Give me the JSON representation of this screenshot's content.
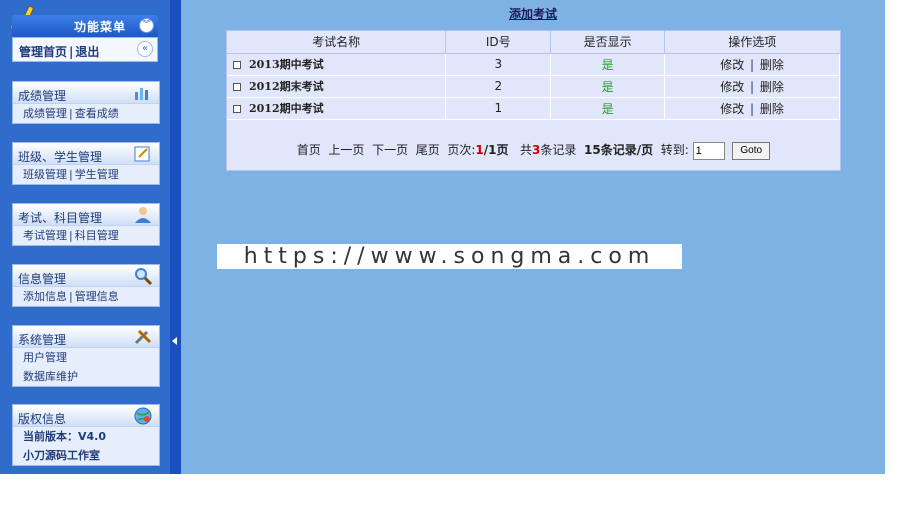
{
  "sidebar": {
    "menu_title": "功能菜单",
    "home_label": "管理首页",
    "logout_label": "退出",
    "blocks": [
      {
        "title": "成绩管理",
        "rows": [
          {
            "a": "成绩管理",
            "b": "查看成绩"
          }
        ]
      },
      {
        "title": "班级、学生管理",
        "rows": [
          {
            "a": "班级管理",
            "b": "学生管理"
          }
        ]
      },
      {
        "title": "考试、科目管理",
        "rows": [
          {
            "a": "考试管理",
            "b": "科目管理"
          }
        ]
      },
      {
        "title": "信息管理",
        "rows": [
          {
            "a": "添加信息",
            "b": "管理信息"
          }
        ]
      },
      {
        "title": "系统管理",
        "rows": [
          {
            "a": "用户管理"
          },
          {
            "a": "数据库维护"
          }
        ]
      },
      {
        "title": "版权信息",
        "rows": [
          {
            "a": "当前版本：V4.0"
          },
          {
            "a": "小刀源码工作室"
          }
        ]
      }
    ]
  },
  "main": {
    "add_link": "添加考试",
    "columns": [
      "考试名称",
      "ID号",
      "是否显示",
      "操作选项"
    ],
    "rows": [
      {
        "name": "2013期中考试",
        "id": "3",
        "show": "是",
        "edit": "修改",
        "del": "删除"
      },
      {
        "name": "2012期末考试",
        "id": "2",
        "show": "是",
        "edit": "修改",
        "del": "删除"
      },
      {
        "name": "2012期中考试",
        "id": "1",
        "show": "是",
        "edit": "修改",
        "del": "删除"
      }
    ],
    "pager": {
      "first": "首页",
      "prev": "上一页",
      "next": "下一页",
      "last": "尾页",
      "page_label": "页次:",
      "current": "1",
      "total": "/1页",
      "records_pre": "共",
      "records_count": "3",
      "records_post": "条记录",
      "per_page": "15条记录/页",
      "goto_label": "转到:",
      "goto_value": "1",
      "goto_button": "Goto"
    }
  },
  "watermark": "https://www.songma.com"
}
